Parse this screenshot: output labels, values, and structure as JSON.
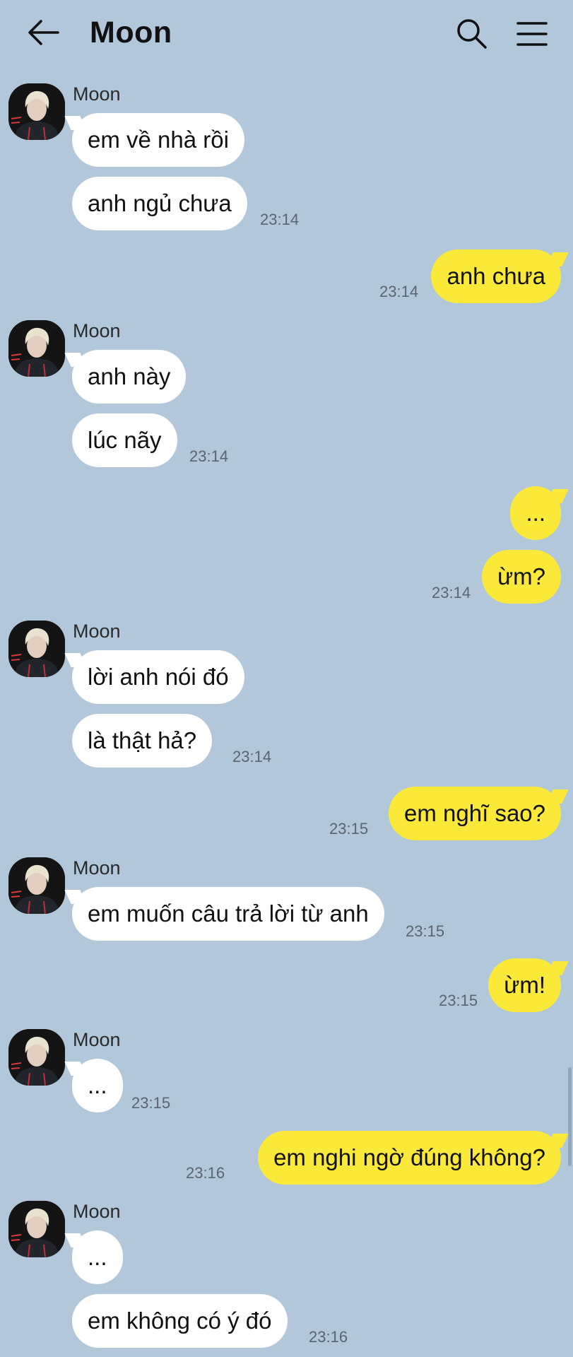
{
  "header": {
    "title": "Moon",
    "back_icon": "arrow-left-icon",
    "search_icon": "search-icon",
    "menu_icon": "hamburger-menu-icon"
  },
  "colors": {
    "background": "#b2c7d9",
    "incoming_bubble": "#ffffff",
    "outgoing_bubble": "#fbe93a"
  },
  "messages": {
    "g1": {
      "sender": "Moon",
      "m1": "em về nhà rồi",
      "m2": "anh ngủ chưa",
      "time": "23:14"
    },
    "g2": {
      "m1": "anh chưa",
      "time": "23:14"
    },
    "g3": {
      "sender": "Moon",
      "m1": "anh này",
      "m2": "lúc nãy",
      "time": "23:14"
    },
    "g4": {
      "m1": "...",
      "m2": "ừm?",
      "time": "23:14"
    },
    "g5": {
      "sender": "Moon",
      "m1": "lời anh nói đó",
      "m2": "là thật hả?",
      "time": "23:14"
    },
    "g6": {
      "m1": "em nghĩ sao?",
      "time": "23:15"
    },
    "g7": {
      "sender": "Moon",
      "m1": "em muốn câu trả lời từ anh",
      "time": "23:15"
    },
    "g8": {
      "m1": "ừm!",
      "time": "23:15"
    },
    "g9": {
      "sender": "Moon",
      "m1": "...",
      "time": "23:15"
    },
    "g10": {
      "m1": "em nghi ngờ đúng không?",
      "time": "23:16"
    },
    "g11": {
      "sender": "Moon",
      "m1": "...",
      "m2": "em không có ý đó",
      "time": "23:16"
    }
  }
}
